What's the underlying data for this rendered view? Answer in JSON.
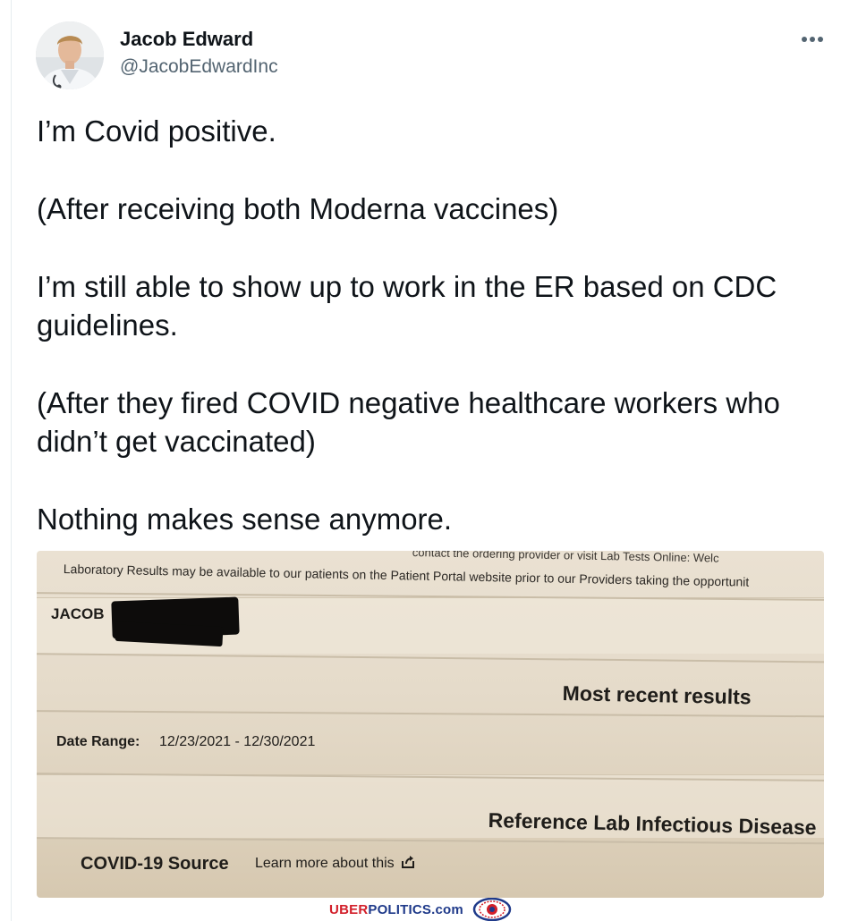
{
  "author": {
    "name": "Jacob Edward",
    "handle": "@JacobEdwardInc",
    "avatar_icon": "profile-photo"
  },
  "more_icon": "more-horizontal-icon",
  "tweet": {
    "paragraphs": [
      "I’m Covid positive.",
      "(After receiving both Moderna vaccines)",
      "I’m still able to show up to work in the ER based on CDC guidelines.",
      "(After they fired COVID negative healthcare workers who didn’t get vaccinated)",
      "Nothing makes sense anymore."
    ]
  },
  "photo": {
    "top_line_1": "contact the ordering provider or visit Lab Tests Online: Welc",
    "top_line_2": "Laboratory Results may be available to our patients on the Patient Portal website prior to our Providers taking the opportunit",
    "patient_name": "JACOB",
    "most_recent": "Most recent results",
    "date_range_label": "Date Range:",
    "date_range_value": "12/23/2021 - 12/30/2021",
    "lab_heading": "Reference Lab Infectious Disease",
    "covid_source": "COVID-19 Source",
    "learn_more": "Learn more about this",
    "learn_more_icon": "external-share-icon"
  },
  "watermark": {
    "red_part": "UBER",
    "blue_part": "POLITICS.com",
    "logo_icon": "lion-crest-logo"
  },
  "colors": {
    "text": "#0f1419",
    "secondary": "#536471",
    "watermark_red": "#d21f2a",
    "watermark_blue": "#1f3a8a"
  }
}
